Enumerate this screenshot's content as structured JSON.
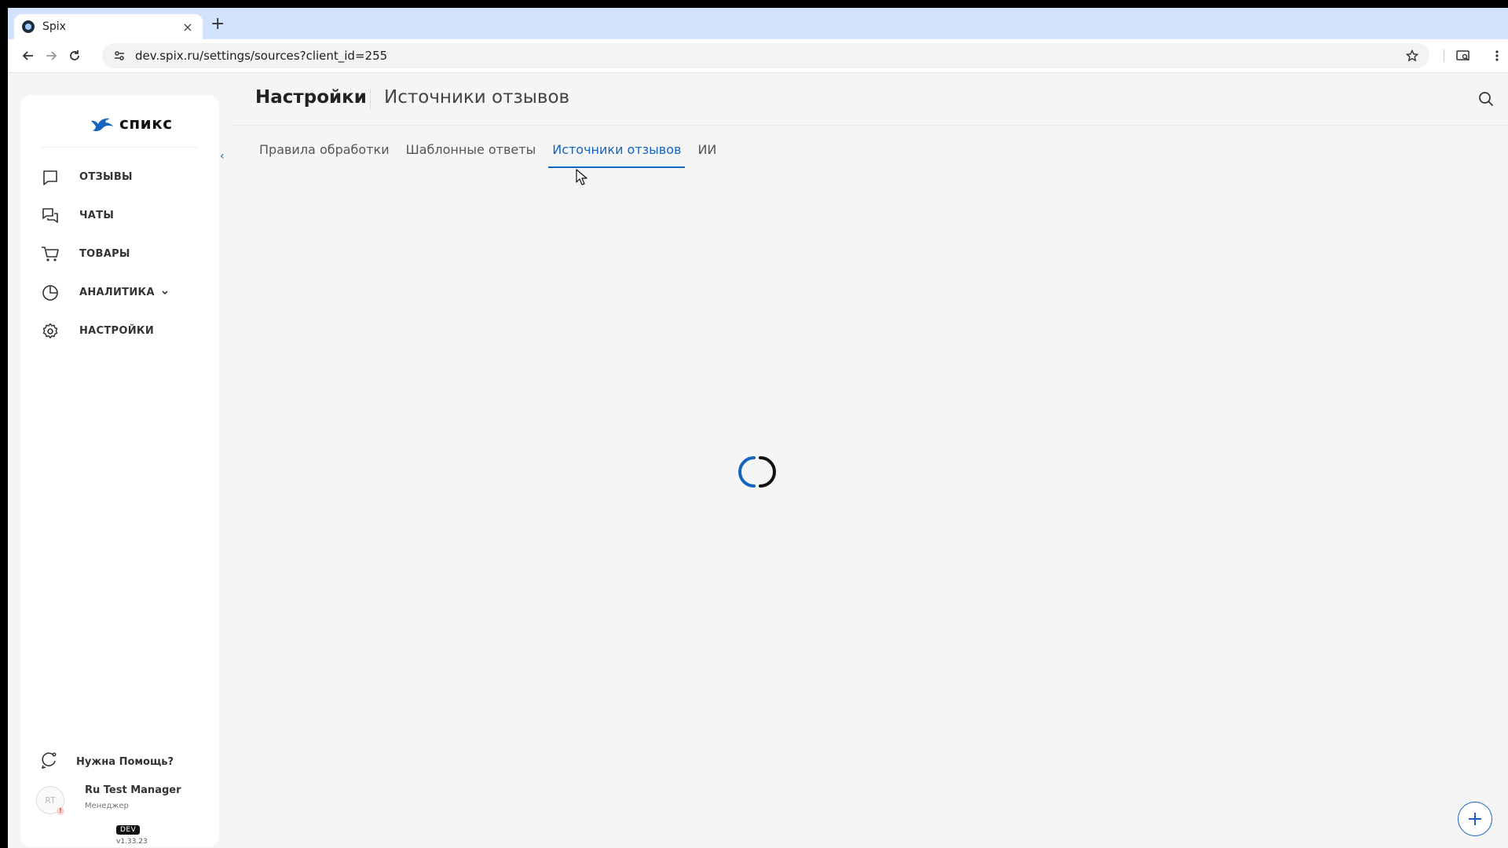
{
  "browser": {
    "tab_title": "Spix",
    "tab_close": "×",
    "new_tab": "+",
    "url": "dev.spix.ru/settings/sources?client_id=255"
  },
  "sidebar": {
    "logo_text": "спикс",
    "collapse": "‹",
    "items": [
      {
        "label": "ОТЗЫВЫ",
        "icon": "chat-square-icon"
      },
      {
        "label": "ЧАТЫ",
        "icon": "chats-icon"
      },
      {
        "label": "ТОВАРЫ",
        "icon": "cart-icon"
      },
      {
        "label": "АНАЛИТИКА",
        "icon": "pie-chart-icon"
      },
      {
        "label": "НАСТРОЙКИ",
        "icon": "gear-icon"
      }
    ],
    "help_label": "Нужна Помощь?",
    "user": {
      "initials": "RT",
      "alert": "!",
      "name": "Ru Test Manager",
      "role": "Менеджер"
    },
    "env_badge": "DEV",
    "version": "v1.33.23"
  },
  "header": {
    "title": "Настройки",
    "subtitle": "Источники отзывов"
  },
  "tabs": [
    {
      "label": "Правила обработки",
      "active": false
    },
    {
      "label": "Шаблонные ответы",
      "active": false
    },
    {
      "label": "Источники отзывов",
      "active": true
    },
    {
      "label": "ИИ",
      "active": false
    }
  ],
  "colors": {
    "accent": "#1565c0",
    "background": "#f5f5f5",
    "tab_strip": "#d3e3fd"
  }
}
